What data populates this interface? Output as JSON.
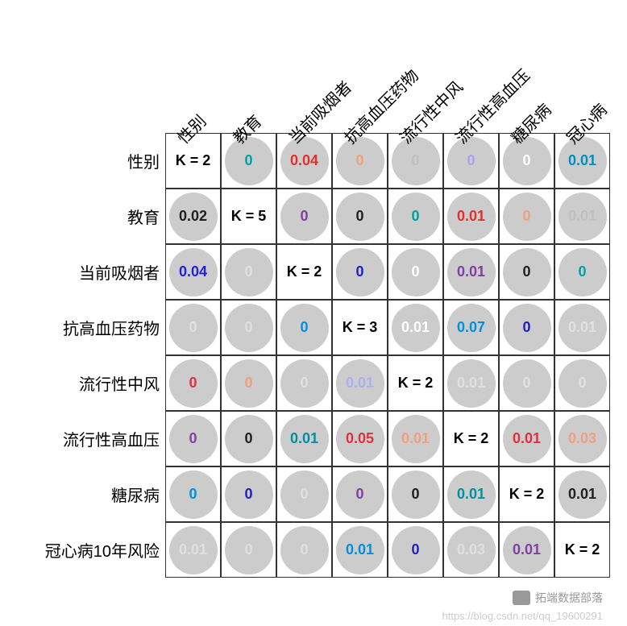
{
  "chart_data": {
    "type": "heatmap",
    "title": "",
    "variables": [
      "性别",
      "教育",
      "当前吸烟者",
      "抗高血压药物",
      "流行性中风",
      "流行性高血压",
      "糖尿病",
      "冠心病10年风险"
    ],
    "row_labels": [
      "性别",
      "教育",
      "当前吸烟者",
      "抗高血压药物",
      "流行性中风",
      "流行性高血压",
      "糖尿病",
      "冠心病10年风险"
    ],
    "col_labels": [
      "性别",
      "教育",
      "当前吸烟者",
      "抗高血压药物",
      "流行性中风",
      "流行性高血压",
      "糖尿病",
      "冠心病"
    ],
    "diagonal_K": [
      2,
      5,
      2,
      3,
      2,
      2,
      2,
      2
    ],
    "matrix": [
      [
        {
          "t": "K = 2",
          "d": true
        },
        {
          "t": "0",
          "c": "#00a0a0"
        },
        {
          "t": "0.04",
          "c": "#e03030"
        },
        {
          "t": "0",
          "c": "#f0a080"
        },
        {
          "t": "0",
          "c": "#c0c0c0"
        },
        {
          "t": "0",
          "c": "#b0a0f0"
        },
        {
          "t": "0",
          "c": "#ffffff"
        },
        {
          "t": "0.01",
          "c": "#0090c0"
        }
      ],
      [
        {
          "t": "0.02",
          "c": "#202020"
        },
        {
          "t": "K = 5",
          "d": true
        },
        {
          "t": "0",
          "c": "#8040a0"
        },
        {
          "t": "0",
          "c": "#202020"
        },
        {
          "t": "0",
          "c": "#00a0a0"
        },
        {
          "t": "0.01",
          "c": "#e03030"
        },
        {
          "t": "0",
          "c": "#f0a080"
        },
        {
          "t": "0.01",
          "c": "#c0c0c0"
        }
      ],
      [
        {
          "t": "0.04",
          "c": "#2020e0"
        },
        {
          "t": "0",
          "c": "#e0e0e0"
        },
        {
          "t": "K = 2",
          "d": true
        },
        {
          "t": "0",
          "c": "#2020c0"
        },
        {
          "t": "0",
          "c": "#ffffff"
        },
        {
          "t": "0.01",
          "c": "#8040a0"
        },
        {
          "t": "0",
          "c": "#202020"
        },
        {
          "t": "0",
          "c": "#00a0a0"
        }
      ],
      [
        {
          "t": "0",
          "c": "#e0e0e0"
        },
        {
          "t": "0",
          "c": "#e0e0e0"
        },
        {
          "t": "0",
          "c": "#0090e0"
        },
        {
          "t": "K = 3",
          "d": true
        },
        {
          "t": "0.01",
          "c": "#ffffff"
        },
        {
          "t": "0.07",
          "c": "#0090e0"
        },
        {
          "t": "0",
          "c": "#2020c0"
        },
        {
          "t": "0.01",
          "c": "#e0e0e0"
        }
      ],
      [
        {
          "t": "0",
          "c": "#e03040"
        },
        {
          "t": "0",
          "c": "#f0a080"
        },
        {
          "t": "0",
          "c": "#e0e0e0"
        },
        {
          "t": "0.01",
          "c": "#b0b0f0"
        },
        {
          "t": "K = 2",
          "d": true
        },
        {
          "t": "0.01",
          "c": "#e0e0e0"
        },
        {
          "t": "0",
          "c": "#e0e0e0"
        },
        {
          "t": "0",
          "c": "#e0e0e0"
        }
      ],
      [
        {
          "t": "0",
          "c": "#8040a0"
        },
        {
          "t": "0",
          "c": "#202020"
        },
        {
          "t": "0.01",
          "c": "#0090a0"
        },
        {
          "t": "0.05",
          "c": "#e03040"
        },
        {
          "t": "0.01",
          "c": "#f0a080"
        },
        {
          "t": "K = 2",
          "d": true
        },
        {
          "t": "0.01",
          "c": "#e03040"
        },
        {
          "t": "0.03",
          "c": "#f0a080"
        }
      ],
      [
        {
          "t": "0",
          "c": "#0090e0"
        },
        {
          "t": "0",
          "c": "#2020c0"
        },
        {
          "t": "0",
          "c": "#e0e0e0"
        },
        {
          "t": "0",
          "c": "#8040a0"
        },
        {
          "t": "0",
          "c": "#202020"
        },
        {
          "t": "0.01",
          "c": "#0090a0"
        },
        {
          "t": "K = 2",
          "d": true
        },
        {
          "t": "0.01",
          "c": "#202020"
        }
      ],
      [
        {
          "t": "0.01",
          "c": "#e0e0e0"
        },
        {
          "t": "0",
          "c": "#e0e0e0"
        },
        {
          "t": "0",
          "c": "#e0e0e0"
        },
        {
          "t": "0.01",
          "c": "#0090e0"
        },
        {
          "t": "0",
          "c": "#2020c0"
        },
        {
          "t": "0.03",
          "c": "#e0e0e0"
        },
        {
          "t": "0.01",
          "c": "#8040a0"
        },
        {
          "t": "K = 2",
          "d": true
        }
      ]
    ]
  },
  "watermark": {
    "text1": "拓端数据部落",
    "text2": "https://blog.csdn.net/qq_19600291"
  }
}
